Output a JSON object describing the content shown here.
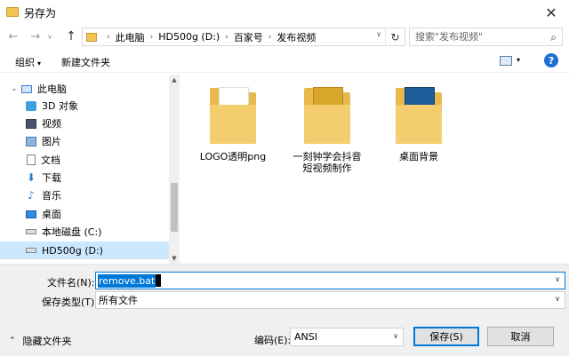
{
  "window": {
    "title": "另存为",
    "close_glyph": "✕"
  },
  "nav": {
    "back": "←",
    "forward": "→",
    "recent": "∨",
    "up": "↑"
  },
  "address": {
    "crumbs": [
      "此电脑",
      "HD500g (D:)",
      "百家号",
      "发布视频"
    ],
    "separator": "›",
    "dropdown": "∨",
    "refresh": "↻"
  },
  "search": {
    "placeholder": "搜索\"发布视频\"",
    "icon": "⌕"
  },
  "toolbar": {
    "organize": "组织",
    "organize_caret": "▾",
    "new_folder": "新建文件夹",
    "view_caret": "▾",
    "help": "?"
  },
  "sidebar": {
    "items": [
      {
        "label": "此电脑",
        "icon": "pc-icon"
      },
      {
        "label": "3D 对象",
        "icon": "3d-objects-icon"
      },
      {
        "label": "视频",
        "icon": "video-icon"
      },
      {
        "label": "图片",
        "icon": "picture-icon"
      },
      {
        "label": "文档",
        "icon": "document-icon"
      },
      {
        "label": "下载",
        "icon": "download-icon"
      },
      {
        "label": "音乐",
        "icon": "music-icon"
      },
      {
        "label": "桌面",
        "icon": "desktop-icon"
      },
      {
        "label": "本地磁盘 (C:)",
        "icon": "drive-icon"
      },
      {
        "label": "HD500g (D:)",
        "icon": "drive-icon"
      }
    ],
    "expand_caret": "⌄",
    "collapsed_caret": "›",
    "selected_index": 9
  },
  "files": [
    {
      "name": "LOGO透明png",
      "icon": "folder-icon"
    },
    {
      "name": "一刻钟学会抖音短视频制作",
      "icon": "folder-icon"
    },
    {
      "name": "桌面背景",
      "icon": "folder-icon"
    }
  ],
  "form": {
    "filename_label": "文件名(N):",
    "filename_value": "remove.bat",
    "filetype_label": "保存类型(T):",
    "filetype_value": "所有文件",
    "encoding_label": "编码(E):",
    "encoding_value": "ANSI",
    "dropdown": "∨"
  },
  "footer": {
    "hide_folders": "隐藏文件夹",
    "hide_caret": "⌃",
    "save": "保存(S)",
    "cancel": "取消"
  },
  "colors": {
    "accent": "#0078d7",
    "selected_row": "#cce8ff",
    "help": "#1f6fd0",
    "folder": "#f3cd6e"
  }
}
